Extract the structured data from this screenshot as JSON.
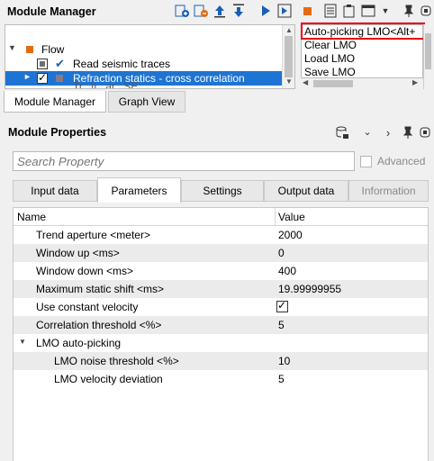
{
  "module_manager": {
    "title": "Module Manager",
    "toolbar_icons": [
      "add-module-icon",
      "insert-module-icon",
      "move-up-icon",
      "move-down-icon",
      "run-icon",
      "run-to-end-icon",
      "stop-icon",
      "list-icon",
      "clipboard-icon",
      "window-icon",
      "dropdown-icon",
      "pin-icon",
      "close-icon"
    ],
    "tree": {
      "root_label": "Flow",
      "items": [
        {
          "label": "Read seismic traces"
        },
        {
          "label": "Refraction statics - cross correlation"
        },
        {
          "label": "Tr...ti...ar...SE"
        }
      ]
    },
    "menu_items": [
      "Auto-picking LMO<Alt+",
      "Clear LMO",
      "Load LMO",
      "Save LMO"
    ],
    "tabs": [
      "Module Manager",
      "Graph View"
    ]
  },
  "module_properties": {
    "title": "Module Properties",
    "search_placeholder": "Search Property",
    "advanced_label": "Advanced",
    "tabs": [
      "Input data",
      "Parameters",
      "Settings",
      "Output data",
      "Information"
    ],
    "columns": {
      "name": "Name",
      "value": "Value"
    },
    "rows": [
      {
        "name": "Trend aperture <meter>",
        "value": "2000"
      },
      {
        "name": "Window up <ms>",
        "value": "0"
      },
      {
        "name": "Window down <ms>",
        "value": "400"
      },
      {
        "name": "Maximum static shift <ms>",
        "value": "19.99999955"
      },
      {
        "name": "Use constant velocity",
        "value": "checked"
      },
      {
        "name": "Correlation threshold <%>",
        "value": "5"
      },
      {
        "name": "LMO auto-picking",
        "value": ""
      },
      {
        "name": "LMO noise threshold <%>",
        "value": "10"
      },
      {
        "name": "LMO velocity deviation",
        "value": "5"
      }
    ]
  },
  "colors": {
    "selection": "#1e74d3",
    "highlight_border": "#e8000e",
    "accent_blue": "#1c5fb8",
    "accent_orange": "#e36b12"
  }
}
